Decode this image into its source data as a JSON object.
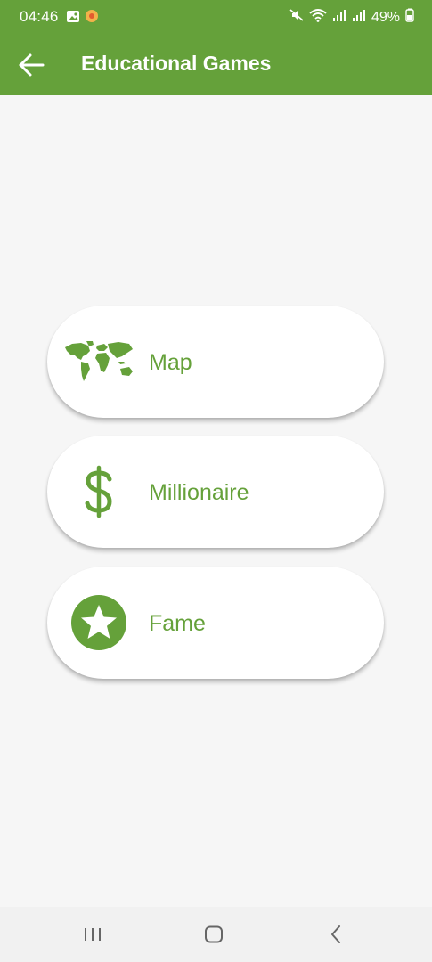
{
  "colors": {
    "primary": "#65a13a",
    "background": "#f6f6f6",
    "card": "#ffffff",
    "navbar": "#f1f1f1"
  },
  "status_bar": {
    "time": "04:46",
    "battery": "49%",
    "icons": [
      "gallery-icon",
      "notification-badge-icon",
      "mute-icon",
      "wifi-icon",
      "signal-icon",
      "signal-icon",
      "battery-charging-icon"
    ]
  },
  "header": {
    "title": "Educational Games",
    "back_icon": "back-arrow-icon"
  },
  "menu": {
    "items": [
      {
        "label": "Map",
        "icon": "world-map-icon"
      },
      {
        "label": "Millionaire",
        "icon": "dollar-icon"
      },
      {
        "label": "Fame",
        "icon": "star-icon"
      }
    ]
  },
  "nav_bar": {
    "buttons": [
      "recent-apps-icon",
      "home-icon",
      "back-icon"
    ]
  }
}
